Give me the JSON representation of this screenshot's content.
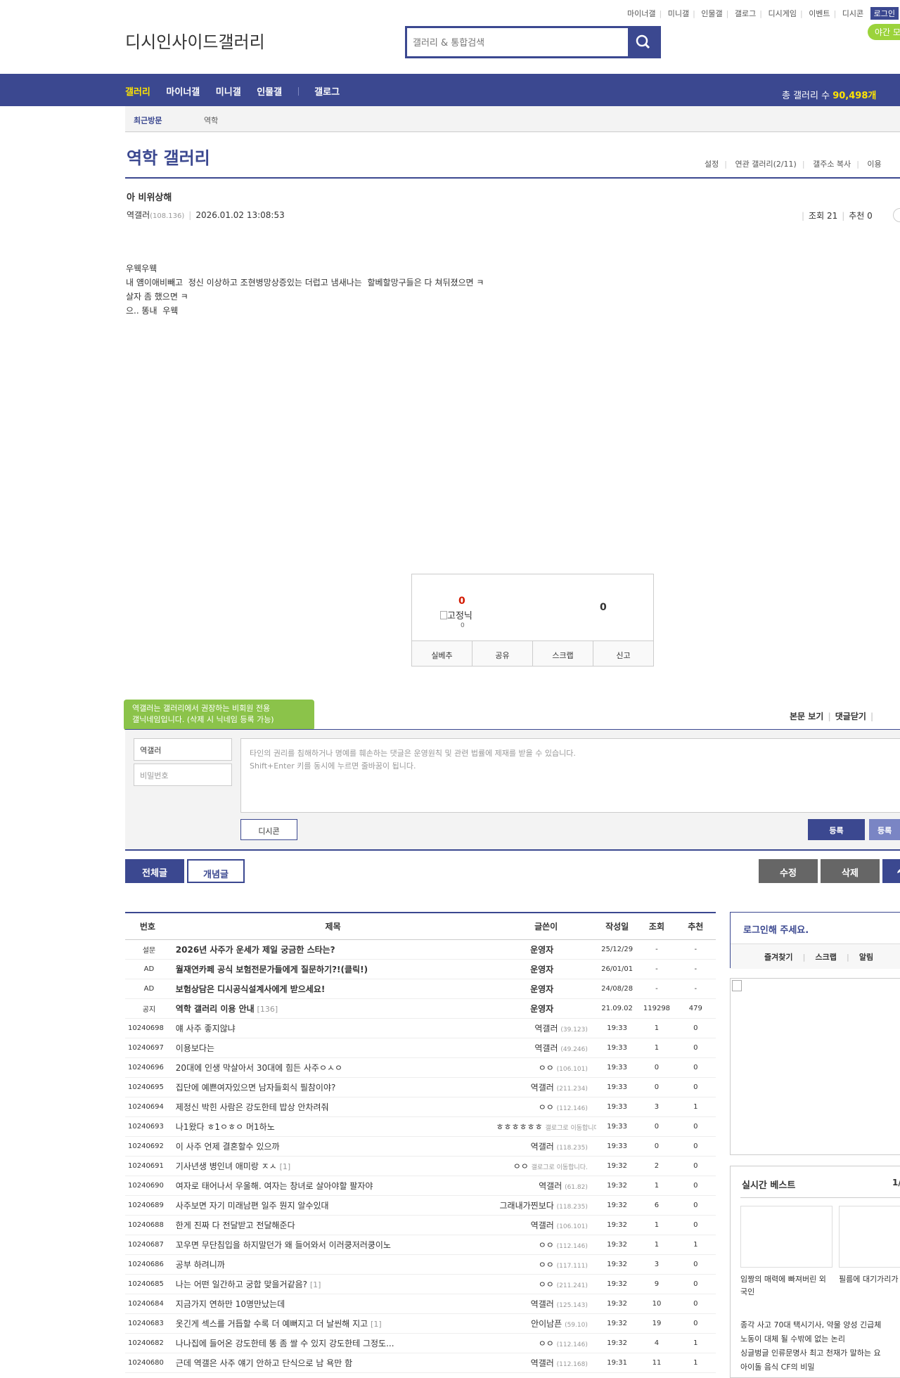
{
  "top_menu": [
    "마이너갤",
    "미니갤",
    "인물갤",
    "갤로그",
    "디시게임",
    "이벤트",
    "디시콘"
  ],
  "login_label": "로그인",
  "night_mode_label": "야간 모",
  "logo_text": "디시인사이드갤러리",
  "search": {
    "placeholder": "갤러리 & 통합검색"
  },
  "gnb": {
    "items": [
      "갤러리",
      "마이너갤",
      "미니갤",
      "인물갤",
      "갤로그"
    ],
    "total_label": "총 갤러리 수",
    "total_count": "90,498개"
  },
  "recent": {
    "label": "최근방문",
    "item": "역학"
  },
  "gallery": {
    "title": "역학 갤러리",
    "menu": [
      "설정",
      "연관 갤러리(2/11)",
      "갤주소 복사",
      "이용"
    ]
  },
  "post": {
    "title": "아 비위상해",
    "author": "역갤러",
    "author_ip": "(108.136)",
    "datetime": "2026.01.02 13:08:53",
    "views_label": "조회 21",
    "recommend_label": "추천 0",
    "body": "우웩우웩\n내 얨이애비빼고  정신 이상하고 조현병망상증있는 더럽고 냄새나는  할베할망구들은 다 쳐뒤졌으면 ㅋ\n살자 좀 했으면 ㅋ\n으.. 똥내  우웩"
  },
  "vote": {
    "up_count": "0",
    "fixed_label": "고정닉",
    "fixed_count": "0",
    "down_count": "0",
    "buttons": [
      "실베추",
      "공유",
      "스크랩",
      "신고"
    ]
  },
  "comment": {
    "tooltip": "역갤러는 갤러리에서 권장하는 비회원 전용\n갤닉네임입니다. (삭제 시 닉네임 등록 가능)",
    "options": [
      "본문 보기",
      "댓글닫기"
    ],
    "nick_value": "역갤러",
    "password_placeholder": "비밀번호",
    "textarea_placeholder": "타인의 권리를 침해하거나 명예를 훼손하는 댓글은 운영원칙 및 관련 법률에 제재를 받을 수 있습니다.\nShift+Enter 키를 동시에 누르면 줄바꿈이 됩니다.",
    "dccon_label": "디시콘",
    "submit_label": "등록",
    "submit2_label": "등록"
  },
  "buttons": {
    "all": "전체글",
    "concept": "개념글",
    "edit": "수정",
    "delete": "삭제"
  },
  "list": {
    "headers": [
      "번호",
      "제목",
      "글쓴이",
      "작성일",
      "조회",
      "추천"
    ],
    "rows": [
      {
        "num": "설문",
        "title": "2026년 사주가 운세가 제일 궁금한 스타는?",
        "writer": "운영자",
        "ip": "",
        "date": "25/12/29",
        "views": "-",
        "rec": "-",
        "bold": true,
        "reply": ""
      },
      {
        "num": "AD",
        "title": "월재연카페 공식 보험전문가들에게 질문하기?!(클릭!)",
        "writer": "운영자",
        "ip": "",
        "date": "26/01/01",
        "views": "-",
        "rec": "-",
        "bold": true,
        "reply": ""
      },
      {
        "num": "AD",
        "title": "보험상담은 디시공식설계사에게 받으세요!",
        "writer": "운영자",
        "ip": "",
        "date": "24/08/28",
        "views": "-",
        "rec": "-",
        "bold": true,
        "reply": ""
      },
      {
        "num": "공지",
        "title": "역학 갤러리 이용 안내",
        "writer": "운영자",
        "ip": "",
        "date": "21.09.02",
        "views": "119298",
        "rec": "479",
        "bold": true,
        "reply": "[136]"
      },
      {
        "num": "10240698",
        "title": "얘 사주 좋지않냐",
        "writer": "역갤러",
        "ip": "(39.123)",
        "date": "19:33",
        "views": "1",
        "rec": "0",
        "bold": false,
        "reply": ""
      },
      {
        "num": "10240697",
        "title": "이용보다는",
        "writer": "역갤러",
        "ip": "(49.246)",
        "date": "19:33",
        "views": "1",
        "rec": "0",
        "bold": false,
        "reply": ""
      },
      {
        "num": "10240696",
        "title": "20대에 인생 막살아서 30대에 힘든 사주ㅇㅅㅇ",
        "writer": "ㅇㅇ",
        "ip": "(106.101)",
        "date": "19:33",
        "views": "0",
        "rec": "0",
        "bold": false,
        "reply": ""
      },
      {
        "num": "10240695",
        "title": "집단에 예쁜여자있으면 남자들회식 필참이야?",
        "writer": "역갤러",
        "ip": "(211.234)",
        "date": "19:33",
        "views": "0",
        "rec": "0",
        "bold": false,
        "reply": ""
      },
      {
        "num": "10240694",
        "title": "제정신 박힌 사람은 강도한테 밥상 안차려줘",
        "writer": "ㅇㅇ",
        "ip": "(112.146)",
        "date": "19:33",
        "views": "3",
        "rec": "1",
        "bold": false,
        "reply": ""
      },
      {
        "num": "10240693",
        "title": "나1왔다 ㅎ1ㅇㅎㅇ 머1하노",
        "writer": "ㅎㅎㅎㅎㅎㅎ",
        "ip": "갤로그로 이동합니다.",
        "date": "19:33",
        "views": "0",
        "rec": "0",
        "bold": false,
        "reply": ""
      },
      {
        "num": "10240692",
        "title": "이 사주 언제 결혼할수 있으까",
        "writer": "역갤러",
        "ip": "(118.235)",
        "date": "19:33",
        "views": "0",
        "rec": "0",
        "bold": false,
        "reply": ""
      },
      {
        "num": "10240691",
        "title": "기사년생 병인녀 애미랑 ㅈㅅ",
        "writer": "ㅇㅇ",
        "ip": "갤로그로 이동합니다.",
        "date": "19:32",
        "views": "2",
        "rec": "0",
        "bold": false,
        "reply": "[1]"
      },
      {
        "num": "10240690",
        "title": "여자로 태어나서 우울해. 여자는 창녀로 살아야할 팔자야",
        "writer": "역갤러",
        "ip": "(61.82)",
        "date": "19:32",
        "views": "1",
        "rec": "0",
        "bold": false,
        "reply": ""
      },
      {
        "num": "10240689",
        "title": "사주보면 자기 미래남편 일주 뭔지 알수있대",
        "writer": "그래내가찐보다",
        "ip": "(118.235)",
        "date": "19:32",
        "views": "6",
        "rec": "0",
        "bold": false,
        "reply": ""
      },
      {
        "num": "10240688",
        "title": "한게 진짜 다 전달받고 전달해준다",
        "writer": "역갤러",
        "ip": "(106.101)",
        "date": "19:32",
        "views": "1",
        "rec": "0",
        "bold": false,
        "reply": ""
      },
      {
        "num": "10240687",
        "title": "꼬우면 무단침입을 하지말던가 왜 들어와서 이러쿵저러쿵이노",
        "writer": "ㅇㅇ",
        "ip": "(112.146)",
        "date": "19:32",
        "views": "1",
        "rec": "1",
        "bold": false,
        "reply": ""
      },
      {
        "num": "10240686",
        "title": "공부 하려니까",
        "writer": "ㅇㅇ",
        "ip": "(117.111)",
        "date": "19:32",
        "views": "3",
        "rec": "0",
        "bold": false,
        "reply": ""
      },
      {
        "num": "10240685",
        "title": "나는 어떤 일간하고 궁합 맞을거같음?",
        "writer": "ㅇㅇ",
        "ip": "(211.241)",
        "date": "19:32",
        "views": "9",
        "rec": "0",
        "bold": false,
        "reply": "[1]"
      },
      {
        "num": "10240684",
        "title": "지금가지 연하만 10명만났는데",
        "writer": "역갤러",
        "ip": "(125.143)",
        "date": "19:32",
        "views": "10",
        "rec": "0",
        "bold": false,
        "reply": ""
      },
      {
        "num": "10240683",
        "title": "옷긴게 섹스를 거듭할 수록 더 예뻐지고 더 날씬해 지고",
        "writer": "안이남픈",
        "ip": "(59.10)",
        "date": "19:32",
        "views": "19",
        "rec": "0",
        "bold": false,
        "reply": "[1]"
      },
      {
        "num": "10240682",
        "title": "나나집에 들어온 강도한테 똥 좀 쌀 수 있지 강도한테 그정도...",
        "writer": "ㅇㅇ",
        "ip": "(112.146)",
        "date": "19:32",
        "views": "4",
        "rec": "1",
        "bold": false,
        "reply": ""
      },
      {
        "num": "10240680",
        "title": "근데 역갤은 사주 얘기 안하고 단식으로 남 욕만 함",
        "writer": "역갤러",
        "ip": "(112.168)",
        "date": "19:31",
        "views": "11",
        "rec": "1",
        "bold": false,
        "reply": ""
      }
    ]
  },
  "sidebar": {
    "login_prompt": "로그인해 주세요.",
    "tabs": [
      "즐겨찾기",
      "스크랩",
      "알림"
    ],
    "best_title": "실시간 베스트",
    "best_page": "1/",
    "best_captions": [
      "임짱의 매력에 빠져버린 외국인",
      "필름에 대기가리가 하는 생각"
    ],
    "best_list": [
      "종각 사고 70대 택시기사, 약물 양성 긴급체",
      "노동이 대체 될 수밖에 없는 논리",
      "싱글벙글 인류문명사 최고 천재가 말하는 요",
      "아이돌 음식 CF의 비밀"
    ]
  }
}
